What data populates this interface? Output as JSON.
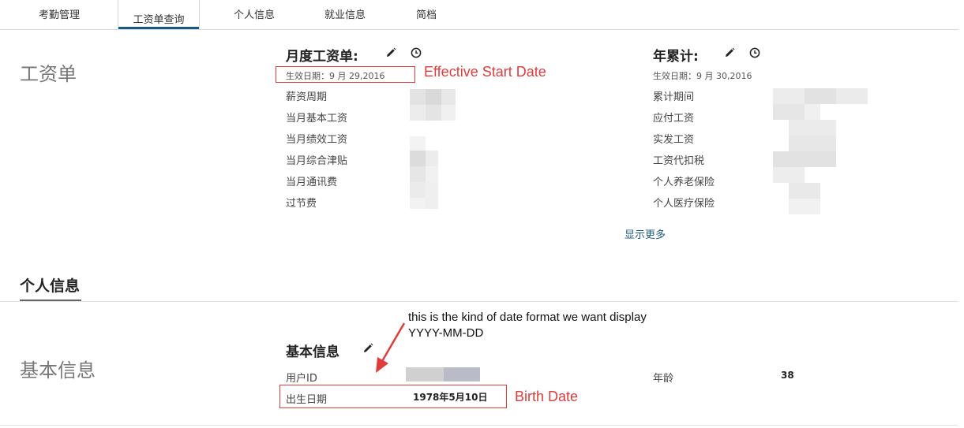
{
  "tabs": [
    {
      "label": "考勤管理"
    },
    {
      "label": "工资单查询"
    },
    {
      "label": "个人信息"
    },
    {
      "label": "就业信息"
    },
    {
      "label": "简档"
    }
  ],
  "payslip": {
    "section_title": "工资单",
    "monthly": {
      "title": "月度工资单:",
      "effective": "生效日期：9 月 29,2016",
      "rows": [
        "薪资周期",
        "当月基本工资",
        "当月绩效工资",
        "当月综合津贴",
        "当月通讯费",
        "过节费"
      ]
    },
    "ytd": {
      "title": "年累计:",
      "effective": "生效日期：9 月 30,2016",
      "rows": [
        "累计期间",
        "应付工资",
        "实发工资",
        "工资代扣税",
        "个人养老保险",
        "个人医疗保险"
      ],
      "show_more": "显示更多"
    }
  },
  "personal": {
    "heading": "个人信息",
    "section_title": "基本信息",
    "card_title": "基本信息",
    "user_id_label": "用户ID",
    "birth_label": "出生日期",
    "birth_value": "1978年5月10日",
    "age_label": "年龄",
    "age_value": "38"
  },
  "annotations": {
    "effective_start": "Effective Start Date",
    "birth_date": "Birth Date",
    "format_note_line1": "this is the kind of date format we want display",
    "format_note_line2": "YYYY-MM-DD",
    "color": "#e03c3c"
  },
  "icons": {
    "edit": "pencil-icon",
    "history": "clock-icon"
  },
  "colors": {
    "accent": "#1a5a7a",
    "link": "#1f5c7c"
  }
}
